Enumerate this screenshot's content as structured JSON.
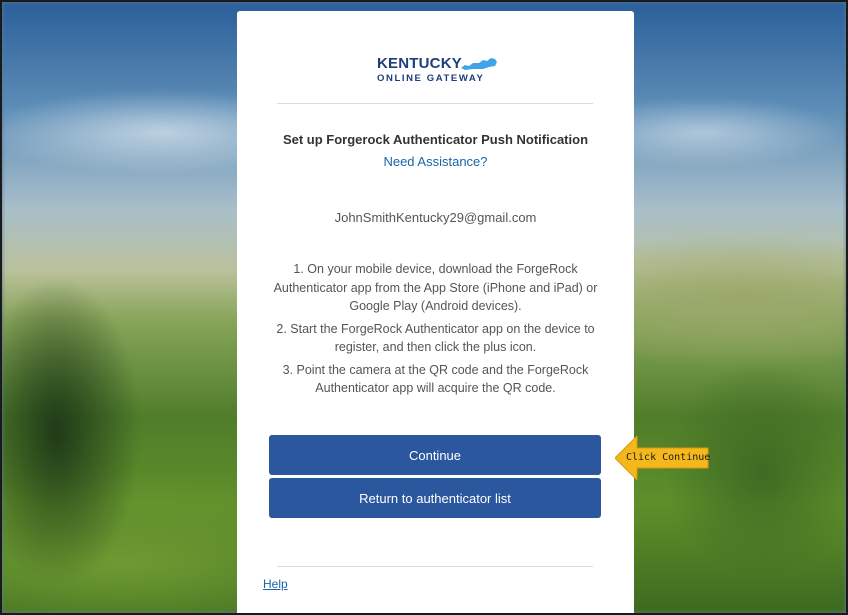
{
  "logo": {
    "line1": "KENTUCKY",
    "line2": "ONLINE GATEWAY",
    "brand_color": "#1d3e7a",
    "accent_color": "#3fa4e8"
  },
  "page": {
    "title": "Set up Forgerock Authenticator Push Notification",
    "assistance_link": "Need Assistance?",
    "email": "JohnSmithKentucky29@gmail.com",
    "steps": [
      "1. On your mobile device, download the ForgeRock Authenticator app from the App Store (iPhone and iPad) or Google Play (Android devices).",
      "2. Start the ForgeRock Authenticator app on the device to register, and then click the plus icon.",
      "3. Point the camera at the QR code and the ForgeRock Authenticator app will acquire the QR code."
    ]
  },
  "buttons": {
    "continue": "Continue",
    "return": "Return to authenticator list",
    "color": "#2b579e"
  },
  "footer": {
    "help": "Help"
  },
  "annotation": {
    "label": "Click Continue",
    "color": "#f5b81c"
  }
}
